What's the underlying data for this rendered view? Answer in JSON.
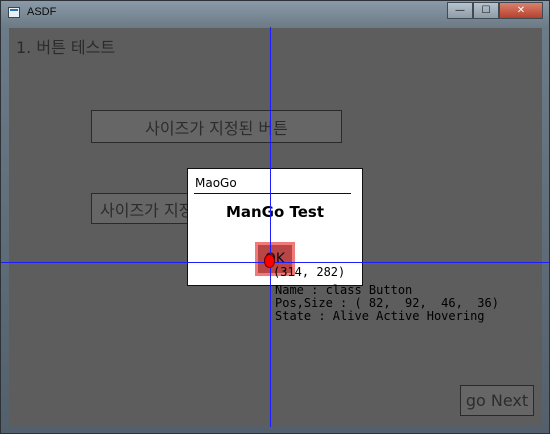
{
  "window": {
    "title": "ASDF",
    "minimize_glyph": "—",
    "maximize_glyph": "☐",
    "close_glyph": "✕"
  },
  "scene": {
    "heading": "1. 버튼 테스트",
    "sized_button_label": "사이즈가 지정된 버튼",
    "sized_button2_label": "사이즈가 지정된 버튼",
    "next_button_label": "go Next"
  },
  "popup": {
    "caption": "MaoGo",
    "title": "ManGo Test",
    "ok_label": "OK"
  },
  "debug": {
    "cursor_coords": "(314, 282)",
    "name_line": "Name : class Button",
    "pos_size_line": "Pos,Size : ( 82,  92,  46,  36)",
    "state_line": "State : Alive Active Hovering"
  },
  "colors": {
    "crosshair": "#1d1dff",
    "cursor": "#ff0000",
    "hover_button": "#b94545"
  }
}
